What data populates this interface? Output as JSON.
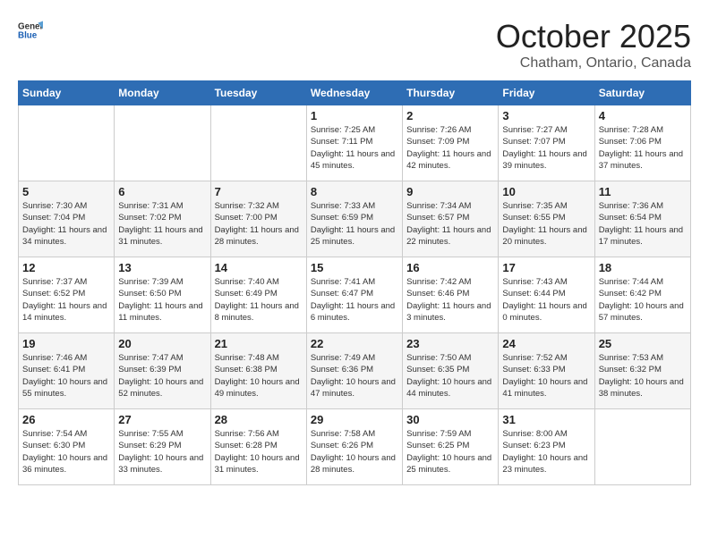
{
  "header": {
    "logo_general": "General",
    "logo_blue": "Blue",
    "month": "October 2025",
    "location": "Chatham, Ontario, Canada"
  },
  "days_of_week": [
    "Sunday",
    "Monday",
    "Tuesday",
    "Wednesday",
    "Thursday",
    "Friday",
    "Saturday"
  ],
  "weeks": [
    [
      {
        "day": "",
        "sunrise": "",
        "sunset": "",
        "daylight": ""
      },
      {
        "day": "",
        "sunrise": "",
        "sunset": "",
        "daylight": ""
      },
      {
        "day": "",
        "sunrise": "",
        "sunset": "",
        "daylight": ""
      },
      {
        "day": "1",
        "sunrise": "Sunrise: 7:25 AM",
        "sunset": "Sunset: 7:11 PM",
        "daylight": "Daylight: 11 hours and 45 minutes."
      },
      {
        "day": "2",
        "sunrise": "Sunrise: 7:26 AM",
        "sunset": "Sunset: 7:09 PM",
        "daylight": "Daylight: 11 hours and 42 minutes."
      },
      {
        "day": "3",
        "sunrise": "Sunrise: 7:27 AM",
        "sunset": "Sunset: 7:07 PM",
        "daylight": "Daylight: 11 hours and 39 minutes."
      },
      {
        "day": "4",
        "sunrise": "Sunrise: 7:28 AM",
        "sunset": "Sunset: 7:06 PM",
        "daylight": "Daylight: 11 hours and 37 minutes."
      }
    ],
    [
      {
        "day": "5",
        "sunrise": "Sunrise: 7:30 AM",
        "sunset": "Sunset: 7:04 PM",
        "daylight": "Daylight: 11 hours and 34 minutes."
      },
      {
        "day": "6",
        "sunrise": "Sunrise: 7:31 AM",
        "sunset": "Sunset: 7:02 PM",
        "daylight": "Daylight: 11 hours and 31 minutes."
      },
      {
        "day": "7",
        "sunrise": "Sunrise: 7:32 AM",
        "sunset": "Sunset: 7:00 PM",
        "daylight": "Daylight: 11 hours and 28 minutes."
      },
      {
        "day": "8",
        "sunrise": "Sunrise: 7:33 AM",
        "sunset": "Sunset: 6:59 PM",
        "daylight": "Daylight: 11 hours and 25 minutes."
      },
      {
        "day": "9",
        "sunrise": "Sunrise: 7:34 AM",
        "sunset": "Sunset: 6:57 PM",
        "daylight": "Daylight: 11 hours and 22 minutes."
      },
      {
        "day": "10",
        "sunrise": "Sunrise: 7:35 AM",
        "sunset": "Sunset: 6:55 PM",
        "daylight": "Daylight: 11 hours and 20 minutes."
      },
      {
        "day": "11",
        "sunrise": "Sunrise: 7:36 AM",
        "sunset": "Sunset: 6:54 PM",
        "daylight": "Daylight: 11 hours and 17 minutes."
      }
    ],
    [
      {
        "day": "12",
        "sunrise": "Sunrise: 7:37 AM",
        "sunset": "Sunset: 6:52 PM",
        "daylight": "Daylight: 11 hours and 14 minutes."
      },
      {
        "day": "13",
        "sunrise": "Sunrise: 7:39 AM",
        "sunset": "Sunset: 6:50 PM",
        "daylight": "Daylight: 11 hours and 11 minutes."
      },
      {
        "day": "14",
        "sunrise": "Sunrise: 7:40 AM",
        "sunset": "Sunset: 6:49 PM",
        "daylight": "Daylight: 11 hours and 8 minutes."
      },
      {
        "day": "15",
        "sunrise": "Sunrise: 7:41 AM",
        "sunset": "Sunset: 6:47 PM",
        "daylight": "Daylight: 11 hours and 6 minutes."
      },
      {
        "day": "16",
        "sunrise": "Sunrise: 7:42 AM",
        "sunset": "Sunset: 6:46 PM",
        "daylight": "Daylight: 11 hours and 3 minutes."
      },
      {
        "day": "17",
        "sunrise": "Sunrise: 7:43 AM",
        "sunset": "Sunset: 6:44 PM",
        "daylight": "Daylight: 11 hours and 0 minutes."
      },
      {
        "day": "18",
        "sunrise": "Sunrise: 7:44 AM",
        "sunset": "Sunset: 6:42 PM",
        "daylight": "Daylight: 10 hours and 57 minutes."
      }
    ],
    [
      {
        "day": "19",
        "sunrise": "Sunrise: 7:46 AM",
        "sunset": "Sunset: 6:41 PM",
        "daylight": "Daylight: 10 hours and 55 minutes."
      },
      {
        "day": "20",
        "sunrise": "Sunrise: 7:47 AM",
        "sunset": "Sunset: 6:39 PM",
        "daylight": "Daylight: 10 hours and 52 minutes."
      },
      {
        "day": "21",
        "sunrise": "Sunrise: 7:48 AM",
        "sunset": "Sunset: 6:38 PM",
        "daylight": "Daylight: 10 hours and 49 minutes."
      },
      {
        "day": "22",
        "sunrise": "Sunrise: 7:49 AM",
        "sunset": "Sunset: 6:36 PM",
        "daylight": "Daylight: 10 hours and 47 minutes."
      },
      {
        "day": "23",
        "sunrise": "Sunrise: 7:50 AM",
        "sunset": "Sunset: 6:35 PM",
        "daylight": "Daylight: 10 hours and 44 minutes."
      },
      {
        "day": "24",
        "sunrise": "Sunrise: 7:52 AM",
        "sunset": "Sunset: 6:33 PM",
        "daylight": "Daylight: 10 hours and 41 minutes."
      },
      {
        "day": "25",
        "sunrise": "Sunrise: 7:53 AM",
        "sunset": "Sunset: 6:32 PM",
        "daylight": "Daylight: 10 hours and 38 minutes."
      }
    ],
    [
      {
        "day": "26",
        "sunrise": "Sunrise: 7:54 AM",
        "sunset": "Sunset: 6:30 PM",
        "daylight": "Daylight: 10 hours and 36 minutes."
      },
      {
        "day": "27",
        "sunrise": "Sunrise: 7:55 AM",
        "sunset": "Sunset: 6:29 PM",
        "daylight": "Daylight: 10 hours and 33 minutes."
      },
      {
        "day": "28",
        "sunrise": "Sunrise: 7:56 AM",
        "sunset": "Sunset: 6:28 PM",
        "daylight": "Daylight: 10 hours and 31 minutes."
      },
      {
        "day": "29",
        "sunrise": "Sunrise: 7:58 AM",
        "sunset": "Sunset: 6:26 PM",
        "daylight": "Daylight: 10 hours and 28 minutes."
      },
      {
        "day": "30",
        "sunrise": "Sunrise: 7:59 AM",
        "sunset": "Sunset: 6:25 PM",
        "daylight": "Daylight: 10 hours and 25 minutes."
      },
      {
        "day": "31",
        "sunrise": "Sunrise: 8:00 AM",
        "sunset": "Sunset: 6:23 PM",
        "daylight": "Daylight: 10 hours and 23 minutes."
      },
      {
        "day": "",
        "sunrise": "",
        "sunset": "",
        "daylight": ""
      }
    ]
  ]
}
